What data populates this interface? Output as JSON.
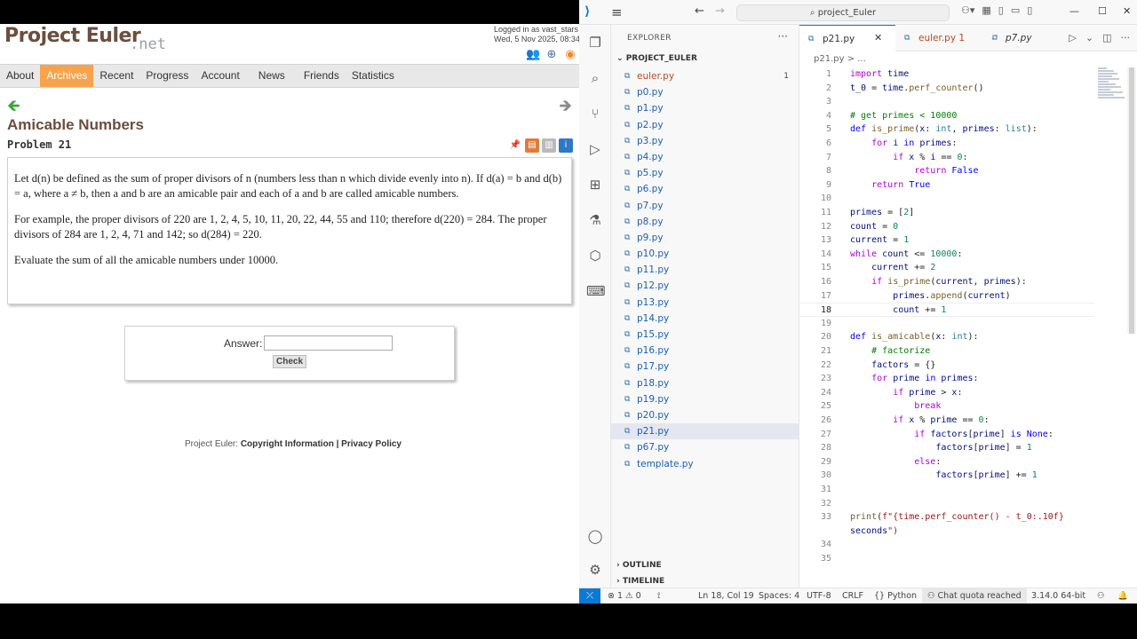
{
  "browser": {
    "logo": "Project Euler",
    "logo_net": ".net",
    "login_line": "Logged in as vast_stars",
    "date_line": "Wed, 5 Nov 2025, 08:34",
    "nav": [
      "About",
      "Archives",
      "Recent",
      "Progress",
      "Account",
      "News",
      "Friends",
      "Statistics"
    ],
    "active_nav": "Archives",
    "problem_title": "Amicable Numbers",
    "problem_subtitle": "Problem 21",
    "paragraph1": "Let d(n) be defined as the sum of proper divisors of n (numbers less than n which divide evenly into n). If d(a) = b and d(b) = a, where a ≠ b, then a and b are an amicable pair and each of a and b are called amicable numbers.",
    "paragraph2": "For example, the proper divisors of 220 are 1, 2, 4, 5, 10, 11, 20, 22, 44, 55 and 110; therefore d(220) = 284. The proper divisors of 284 are 1, 2, 4, 71 and 142; so d(284) = 220.",
    "paragraph3": "Evaluate the sum of all the amicable numbers under 10000.",
    "answer_label": "Answer:",
    "answer_value": "",
    "check_label": "Check",
    "footer_prefix": "Project Euler: ",
    "footer_link1": "Copyright Information",
    "footer_sep": " | ",
    "footer_link2": "Privacy Policy"
  },
  "vscode": {
    "search": "project_Euler",
    "explorer_title": "EXPLORER",
    "folder": "PROJECT_EULER",
    "files": [
      {
        "name": "euler.py",
        "badge": "1",
        "error": true
      },
      {
        "name": "p0.py"
      },
      {
        "name": "p1.py"
      },
      {
        "name": "p2.py"
      },
      {
        "name": "p3.py"
      },
      {
        "name": "p4.py"
      },
      {
        "name": "p5.py"
      },
      {
        "name": "p6.py"
      },
      {
        "name": "p7.py"
      },
      {
        "name": "p8.py"
      },
      {
        "name": "p9.py"
      },
      {
        "name": "p10.py"
      },
      {
        "name": "p11.py"
      },
      {
        "name": "p12.py"
      },
      {
        "name": "p13.py"
      },
      {
        "name": "p14.py"
      },
      {
        "name": "p15.py"
      },
      {
        "name": "p16.py"
      },
      {
        "name": "p17.py"
      },
      {
        "name": "p18.py"
      },
      {
        "name": "p19.py"
      },
      {
        "name": "p20.py"
      },
      {
        "name": "p21.py",
        "selected": true
      },
      {
        "name": "p67.py"
      },
      {
        "name": "template.py"
      }
    ],
    "outline": "OUTLINE",
    "timeline": "TIMELINE",
    "tabs": [
      {
        "label": "p21.py",
        "active": true
      },
      {
        "label": "euler.py",
        "badge": "1"
      },
      {
        "label": "p7.py"
      }
    ],
    "breadcrumb": "p21.py > ...",
    "code_lines": [
      "import time",
      "t_0 = time.perf_counter()",
      "",
      "# get primes < 10000",
      "def is_prime(x: int, primes: list):",
      "    for i in primes:",
      "        if x % i == 0:",
      "            return False",
      "    return True",
      "",
      "primes = [2]",
      "count = 0",
      "current = 1",
      "while count <= 10000:",
      "    current += 2",
      "    if is_prime(current, primes):",
      "        primes.append(current)",
      "        count += 1",
      "",
      "def is_amicable(x: int):",
      "    # factorize",
      "    factors = {}",
      "    for prime in primes:",
      "        if prime > x:",
      "            break",
      "        if x % prime == 0:",
      "            if factors[prime] is None:",
      "                factors[prime] = 1",
      "            else:",
      "                factors[prime] += 1",
      "",
      "",
      "print(f\"{time.perf_counter() - t_0:.10f}",
      "seconds\")",
      "",
      ""
    ],
    "line_numbers": [
      "1",
      "2",
      "3",
      "4",
      "5",
      "6",
      "7",
      "8",
      "9",
      "10",
      "11",
      "12",
      "13",
      "14",
      "15",
      "16",
      "17",
      "18",
      "19",
      "20",
      "21",
      "22",
      "23",
      "24",
      "25",
      "26",
      "27",
      "28",
      "29",
      "30",
      "31",
      "32",
      "33",
      "",
      "34",
      "35"
    ],
    "current_line": "18",
    "status": {
      "errors": "⊗ 1 ⚠ 0",
      "position": "Ln 18, Col 19",
      "spaces": "Spaces: 4",
      "encoding": "UTF-8",
      "eol": "CRLF",
      "language": "{} Python",
      "quota": "Chat quota reached",
      "interpreter": "3.14.0 64-bit"
    }
  }
}
